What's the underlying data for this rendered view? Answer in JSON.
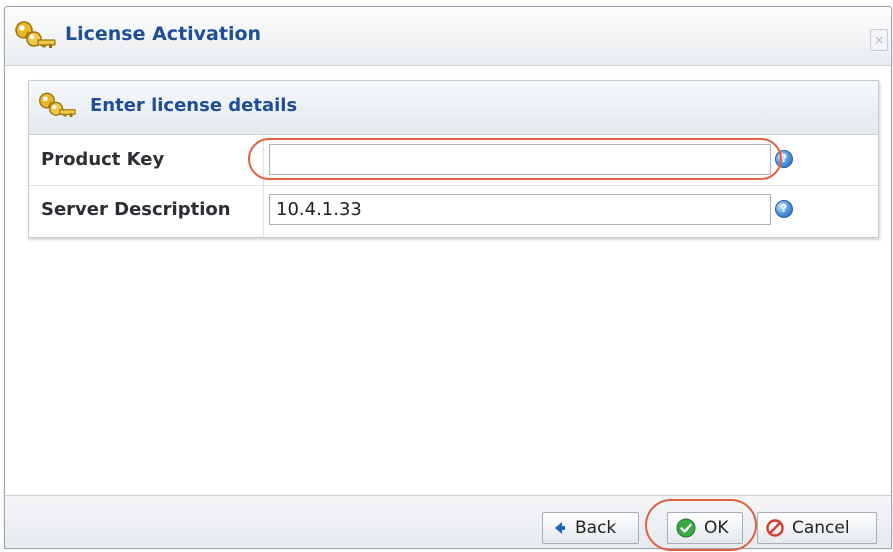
{
  "dialog": {
    "title": "License Activation",
    "close_glyph": "×",
    "title_icon": "keys-icon"
  },
  "panel": {
    "title": "Enter license details",
    "icon": "keys-icon",
    "fields": [
      {
        "label": "Product Key",
        "value": "",
        "help_glyph": "?"
      },
      {
        "label": "Server Description",
        "value": "10.4.1.33",
        "help_glyph": "?"
      }
    ]
  },
  "footer": {
    "back_label": "Back",
    "ok_label": "OK",
    "cancel_label": "Cancel"
  },
  "colors": {
    "title": "#1f4e96",
    "highlight": "#e0603f"
  }
}
